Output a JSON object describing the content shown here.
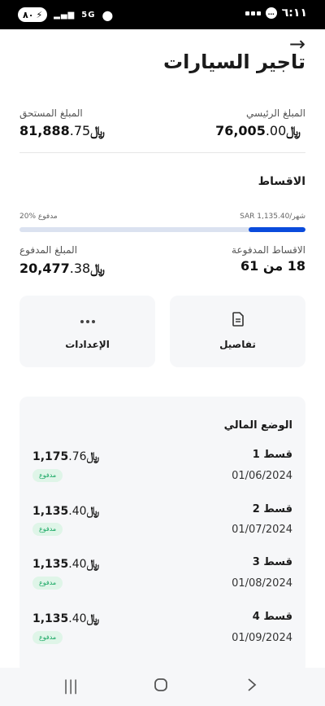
{
  "status": {
    "battery": "٨٠",
    "network": "5G",
    "time": "٦:١١",
    "chat_icon": "chat-icon",
    "sim_label": "..."
  },
  "header": {
    "back_icon": "→",
    "title": "تاجير السيارات"
  },
  "summary": {
    "principal_label": "المبلغ الرئيسي",
    "principal_int": "76,005",
    "principal_dec": ".00",
    "due_label": "المبلغ المستحق",
    "due_int": "81,888",
    "due_dec": ".75",
    "currency": "﷼"
  },
  "installments": {
    "section_title": "الاقساط",
    "monthly_text": "SAR 1,135.40/شهر",
    "paid_percent_text": "20% مدفوع",
    "progress_fraction": 0.2,
    "paid_count_label": "الاقساط المدفوعة",
    "paid_count_value": "18 من 61",
    "paid_amount_label": "المبلغ المدفوع",
    "paid_amount_int": "20,477",
    "paid_amount_dec": ".38"
  },
  "actions": {
    "details_label": "تفاصيل",
    "settings_label": "الإعدادات"
  },
  "financial": {
    "title": "الوضع المالي",
    "items": [
      {
        "name": "قسط 1",
        "date": "01/06/2024",
        "amount_int": "1,175",
        "amount_dec": ".76",
        "status": "مدفوع"
      },
      {
        "name": "قسط 2",
        "date": "01/07/2024",
        "amount_int": "1,135",
        "amount_dec": ".40",
        "status": "مدفوع"
      },
      {
        "name": "قسط 3",
        "date": "01/08/2024",
        "amount_int": "1,135",
        "amount_dec": ".40",
        "status": "مدفوع"
      },
      {
        "name": "قسط 4",
        "date": "01/09/2024",
        "amount_int": "1,135",
        "amount_dec": ".40",
        "status": "مدفوع"
      }
    ]
  },
  "colors": {
    "accent": "#0a4bdc",
    "paid_badge_bg": "#dff5e8",
    "paid_badge_text": "#1aa864"
  }
}
